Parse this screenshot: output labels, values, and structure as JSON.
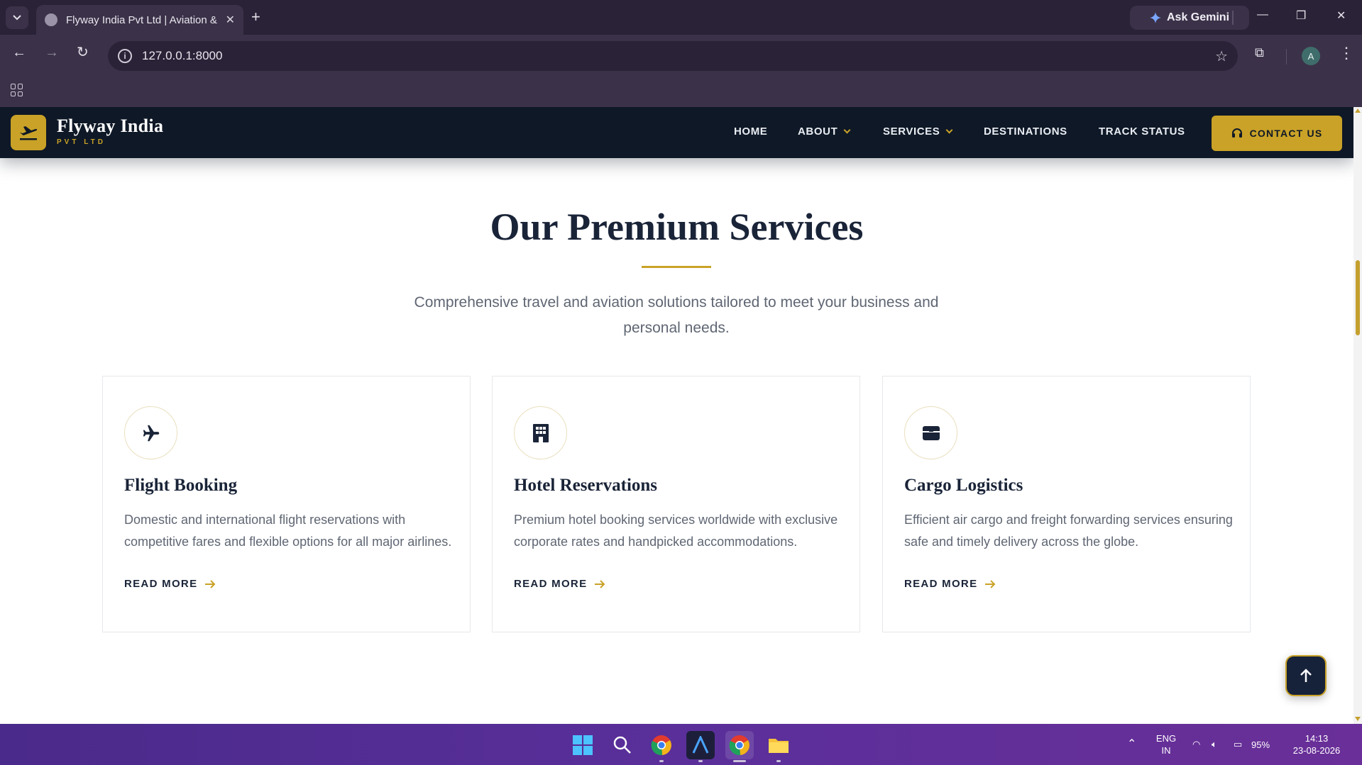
{
  "browser": {
    "tab_title": "Flyway India Pvt Ltd | Aviation & ...",
    "url": "127.0.0.1:8000",
    "gemini_label": "Ask Gemini",
    "profile_initial": "A"
  },
  "site": {
    "brand_name": "Flyway India",
    "brand_sub": "PVT LTD",
    "nav": {
      "home": "HOME",
      "about": "ABOUT",
      "services": "SERVICES",
      "destinations": "DESTINATIONS",
      "track_status": "TRACK STATUS",
      "contact": "CONTACT US"
    },
    "accent_color": "#c9a227",
    "header_color": "#0f1826"
  },
  "section": {
    "title": "Our Premium Services",
    "description": "Comprehensive travel and aviation solutions tailored to meet your business and personal needs."
  },
  "cards": [
    {
      "icon": "plane-icon",
      "title": "Flight Booking",
      "text": "Domestic and international flight reservations with competitive fares and flexible options for all major airlines.",
      "link": "READ MORE"
    },
    {
      "icon": "hotel-icon",
      "title": "Hotel Reservations",
      "text": "Premium hotel booking services worldwide with exclusive corporate rates and handpicked accommodations.",
      "link": "READ MORE"
    },
    {
      "icon": "box-icon",
      "title": "Cargo Logistics",
      "text": "Efficient air cargo and freight forwarding services ensuring safe and timely delivery across the globe.",
      "link": "READ MORE"
    }
  ],
  "taskbar": {
    "lang": "ENG",
    "region": "IN",
    "battery": "95%",
    "time": "14:13",
    "date": "23-08-2026"
  }
}
